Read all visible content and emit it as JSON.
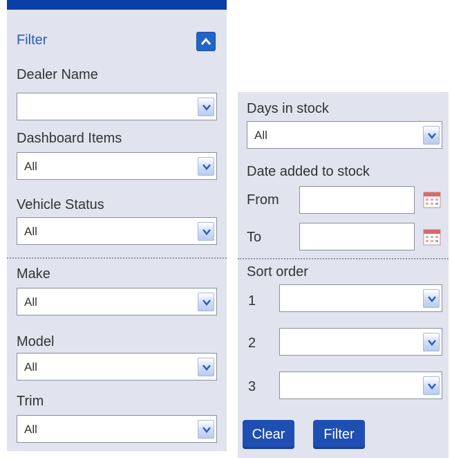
{
  "filter_panel": {
    "title": "Filter",
    "dealer_name": {
      "label": "Dealer Name",
      "value": ""
    },
    "dashboard_items": {
      "label": "Dashboard Items",
      "value": "All"
    },
    "vehicle_status": {
      "label": "Vehicle Status",
      "value": "All"
    },
    "make": {
      "label": "Make",
      "value": "All"
    },
    "model": {
      "label": "Model",
      "value": "All"
    },
    "trim": {
      "label": "Trim",
      "value": "All"
    }
  },
  "right_panel": {
    "days_in_stock": {
      "label": "Days in stock",
      "value": "All"
    },
    "date_added": {
      "label": "Date added to stock",
      "from_label": "From",
      "to_label": "To",
      "from_value": "",
      "to_value": ""
    },
    "sort_order": {
      "label": "Sort order",
      "rows": [
        {
          "number": "1",
          "value": ""
        },
        {
          "number": "2",
          "value": ""
        },
        {
          "number": "3",
          "value": ""
        }
      ]
    },
    "buttons": {
      "clear": "Clear",
      "filter": "Filter"
    }
  },
  "icons": {
    "collapse": "chevron-up-icon",
    "dropdown": "chevron-down-icon",
    "calendar": "calendar-icon"
  },
  "colors": {
    "panel_bg": "#e1e3ef",
    "accent": "#0b3fa8",
    "button_bg": "#1f4fb3",
    "title_text": "#2e5db7"
  }
}
